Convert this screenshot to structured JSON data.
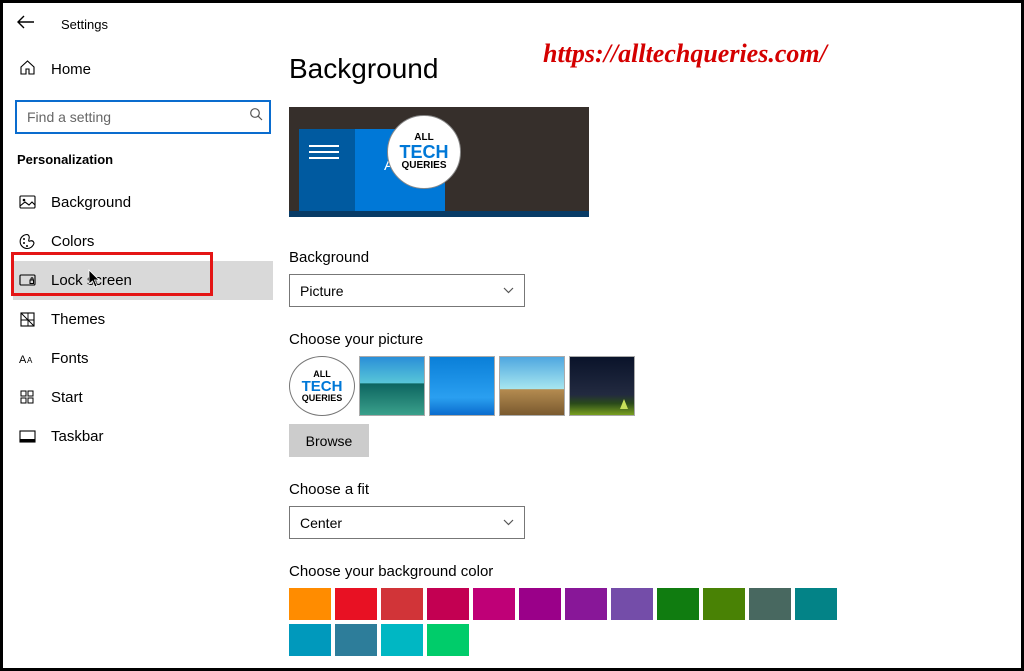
{
  "header": {
    "title": "Settings"
  },
  "watermark": "https://alltechqueries.com/",
  "sidebar": {
    "home": "Home",
    "search_placeholder": "Find a setting",
    "section": "Personalization",
    "items": [
      {
        "label": "Background",
        "selected": false
      },
      {
        "label": "Colors",
        "selected": false
      },
      {
        "label": "Lock screen",
        "selected": true,
        "highlighted": true
      },
      {
        "label": "Themes",
        "selected": false
      },
      {
        "label": "Fonts",
        "selected": false
      },
      {
        "label": "Start",
        "selected": false
      },
      {
        "label": "Taskbar",
        "selected": false
      }
    ]
  },
  "main": {
    "title": "Background",
    "preview_text": "Aa",
    "bg_label": "Background",
    "bg_value": "Picture",
    "choose_pic_label": "Choose your picture",
    "browse_label": "Browse",
    "fit_label": "Choose a fit",
    "fit_value": "Center",
    "color_label": "Choose your background color",
    "colors_row1": [
      "#ff8c00",
      "#e81123",
      "#d13438",
      "#c30052",
      "#bf0077",
      "#9a0089",
      "#881798",
      "#744da9"
    ],
    "colors_row2": [
      "#107c10",
      "#498205",
      "#486860",
      "#038387",
      "#0099bc",
      "#2d7d9a",
      "#00b7c3",
      "#00cc6a"
    ]
  }
}
